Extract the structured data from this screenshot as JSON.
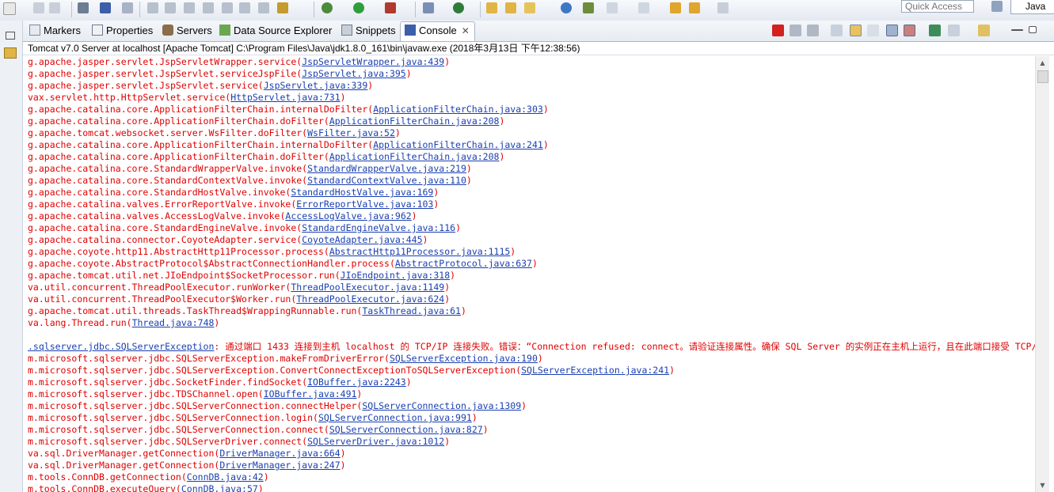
{
  "toolbar": {
    "quick_access_placeholder": "Quick Access",
    "perspective_label": "Java"
  },
  "tabs": [
    {
      "label": "Markers"
    },
    {
      "label": "Properties"
    },
    {
      "label": "Servers"
    },
    {
      "label": "Data Source Explorer"
    },
    {
      "label": "Snippets"
    },
    {
      "label": "Console"
    }
  ],
  "console_tab_close": "✕",
  "info_line": "Tomcat v7.0 Server at localhost [Apache Tomcat] C:\\Program Files\\Java\\jdk1.8.0_161\\bin\\javaw.exe (2018年3月13日 下午12:38:56)",
  "console_lines": [
    {
      "pre": "g.apache.jasper.servlet.JspServletWrapper.service(",
      "link": "JspServletWrapper.java:439",
      "post": ")"
    },
    {
      "pre": "g.apache.jasper.servlet.JspServlet.serviceJspFile(",
      "link": "JspServlet.java:395",
      "post": ")"
    },
    {
      "pre": "g.apache.jasper.servlet.JspServlet.service(",
      "link": "JspServlet.java:339",
      "post": ")"
    },
    {
      "pre": "vax.servlet.http.HttpServlet.service(",
      "link": "HttpServlet.java:731",
      "post": ")"
    },
    {
      "pre": "g.apache.catalina.core.ApplicationFilterChain.internalDoFilter(",
      "link": "ApplicationFilterChain.java:303",
      "post": ")"
    },
    {
      "pre": "g.apache.catalina.core.ApplicationFilterChain.doFilter(",
      "link": "ApplicationFilterChain.java:208",
      "post": ")"
    },
    {
      "pre": "g.apache.tomcat.websocket.server.WsFilter.doFilter(",
      "link": "WsFilter.java:52",
      "post": ")"
    },
    {
      "pre": "g.apache.catalina.core.ApplicationFilterChain.internalDoFilter(",
      "link": "ApplicationFilterChain.java:241",
      "post": ")"
    },
    {
      "pre": "g.apache.catalina.core.ApplicationFilterChain.doFilter(",
      "link": "ApplicationFilterChain.java:208",
      "post": ")"
    },
    {
      "pre": "g.apache.catalina.core.StandardWrapperValve.invoke(",
      "link": "StandardWrapperValve.java:219",
      "post": ")"
    },
    {
      "pre": "g.apache.catalina.core.StandardContextValve.invoke(",
      "link": "StandardContextValve.java:110",
      "post": ")"
    },
    {
      "pre": "g.apache.catalina.core.StandardHostValve.invoke(",
      "link": "StandardHostValve.java:169",
      "post": ")"
    },
    {
      "pre": "g.apache.catalina.valves.ErrorReportValve.invoke(",
      "link": "ErrorReportValve.java:103",
      "post": ")"
    },
    {
      "pre": "g.apache.catalina.valves.AccessLogValve.invoke(",
      "link": "AccessLogValve.java:962",
      "post": ")"
    },
    {
      "pre": "g.apache.catalina.core.StandardEngineValve.invoke(",
      "link": "StandardEngineValve.java:116",
      "post": ")"
    },
    {
      "pre": "g.apache.catalina.connector.CoyoteAdapter.service(",
      "link": "CoyoteAdapter.java:445",
      "post": ")"
    },
    {
      "pre": "g.apache.coyote.http11.AbstractHttp11Processor.process(",
      "link": "AbstractHttp11Processor.java:1115",
      "post": ")"
    },
    {
      "pre": "g.apache.coyote.AbstractProtocol$AbstractConnectionHandler.process(",
      "link": "AbstractProtocol.java:637",
      "post": ")"
    },
    {
      "pre": "g.apache.tomcat.util.net.JIoEndpoint$SocketProcessor.run(",
      "link": "JIoEndpoint.java:318",
      "post": ")"
    },
    {
      "pre": "va.util.concurrent.ThreadPoolExecutor.runWorker(",
      "link": "ThreadPoolExecutor.java:1149",
      "post": ")"
    },
    {
      "pre": "va.util.concurrent.ThreadPoolExecutor$Worker.run(",
      "link": "ThreadPoolExecutor.java:624",
      "post": ")"
    },
    {
      "pre": "g.apache.tomcat.util.threads.TaskThread$WrappingRunnable.run(",
      "link": "TaskThread.java:61",
      "post": ")"
    },
    {
      "pre": "va.lang.Thread.run(",
      "link": "Thread.java:748",
      "post": ")"
    },
    {
      "pre": "",
      "link": "",
      "post": ""
    },
    {
      "pre": "",
      "link": ".sqlserver.jdbc.SQLServerException",
      "post": ": 通过端口 1433 连接到主机 localhost 的 TCP/IP 连接失败。错误：“Connection refused: connect。请验证连接属性。确保 SQL Server 的实例正在主机上运行，且在此端口接受 TCP/IP 连接，还要确保防火墙没有阻"
    },
    {
      "pre": "m.microsoft.sqlserver.jdbc.SQLServerException.makeFromDriverError(",
      "link": "SQLServerException.java:190",
      "post": ")"
    },
    {
      "pre": "m.microsoft.sqlserver.jdbc.SQLServerException.ConvertConnectExceptionToSQLServerException(",
      "link": "SQLServerException.java:241",
      "post": ")"
    },
    {
      "pre": "m.microsoft.sqlserver.jdbc.SocketFinder.findSocket(",
      "link": "IOBuffer.java:2243",
      "post": ")"
    },
    {
      "pre": "m.microsoft.sqlserver.jdbc.TDSChannel.open(",
      "link": "IOBuffer.java:491",
      "post": ")"
    },
    {
      "pre": "m.microsoft.sqlserver.jdbc.SQLServerConnection.connectHelper(",
      "link": "SQLServerConnection.java:1309",
      "post": ")"
    },
    {
      "pre": "m.microsoft.sqlserver.jdbc.SQLServerConnection.login(",
      "link": "SQLServerConnection.java:991",
      "post": ")"
    },
    {
      "pre": "m.microsoft.sqlserver.jdbc.SQLServerConnection.connect(",
      "link": "SQLServerConnection.java:827",
      "post": ")"
    },
    {
      "pre": "m.microsoft.sqlserver.jdbc.SQLServerDriver.connect(",
      "link": "SQLServerDriver.java:1012",
      "post": ")"
    },
    {
      "pre": "va.sql.DriverManager.getConnection(",
      "link": "DriverManager.java:664",
      "post": ")"
    },
    {
      "pre": "va.sql.DriverManager.getConnection(",
      "link": "DriverManager.java:247",
      "post": ")"
    },
    {
      "pre": "m.tools.ConnDB.getConnection(",
      "link": "ConnDB.java:42",
      "post": ")"
    },
    {
      "pre": "m.tools.ConnDB.executeQuery(",
      "link": "ConnDB.java:57",
      "post": ")"
    }
  ],
  "colors": {
    "error_text": "#e00000",
    "link_text": "#1a3fb0"
  }
}
